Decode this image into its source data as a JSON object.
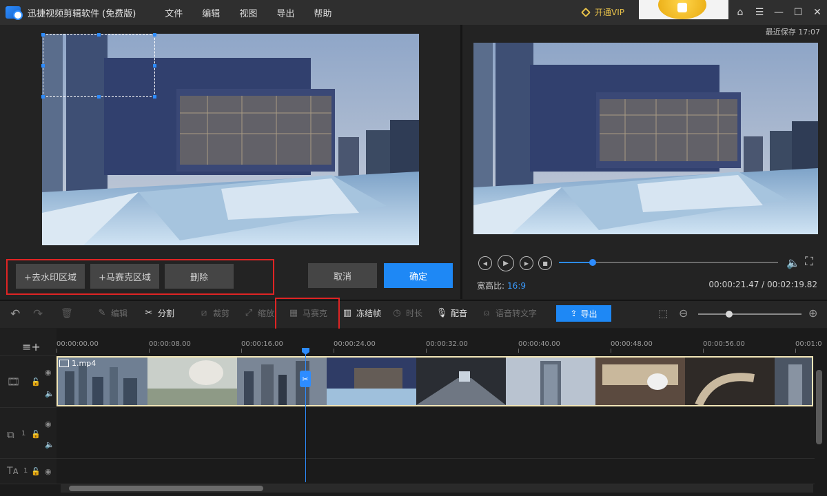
{
  "app": {
    "title": "迅捷视频剪辑软件 (免费版)",
    "menu": [
      "文件",
      "编辑",
      "视图",
      "导出",
      "帮助"
    ],
    "vip_label": "开通VIP",
    "window_buttons": [
      "home-icon",
      "menu-icon",
      "minimize-icon",
      "maximize-icon",
      "close-icon"
    ]
  },
  "editor": {
    "remove_watermark_label": "+去水印区域",
    "mosaic_area_label": "+马赛克区域",
    "delete_label": "删除",
    "cancel_label": "取消",
    "confirm_label": "确定"
  },
  "preview": {
    "last_save": "最近保存 17:07",
    "aspect_label": "宽高比:",
    "aspect_value": "16:9",
    "current_time": "00:00:21.47",
    "total_time": "00:02:19.82",
    "time_separator": " / ",
    "progress_fraction": 0.153
  },
  "toolbar": {
    "items": [
      {
        "label": "编辑",
        "enabled": false
      },
      {
        "label": "分割",
        "enabled": true
      },
      {
        "label": "裁剪",
        "enabled": false
      },
      {
        "label": "缩放",
        "enabled": false
      },
      {
        "label": "马赛克",
        "enabled": false
      },
      {
        "label": "冻结帧",
        "enabled": true
      },
      {
        "label": "时长",
        "enabled": false
      },
      {
        "label": "配音",
        "enabled": true
      },
      {
        "label": "语音转文字",
        "enabled": false
      }
    ],
    "export_label": "导出",
    "zoom_fraction": 0.3
  },
  "timeline": {
    "ruler": [
      "00:00:00.00",
      "00:00:08.00",
      "00:00:16.00",
      "00:00:24.00",
      "00:00:32.00",
      "00:00:40.00",
      "00:00:48.00",
      "00:00:56.00",
      "00:01:0"
    ],
    "clip_name": "1.mp4",
    "track1_index": "1",
    "track2_index": "1"
  },
  "colors": {
    "accent": "#1e88f5",
    "highlight_frame": "#e02424",
    "vip": "#e8c24a"
  }
}
